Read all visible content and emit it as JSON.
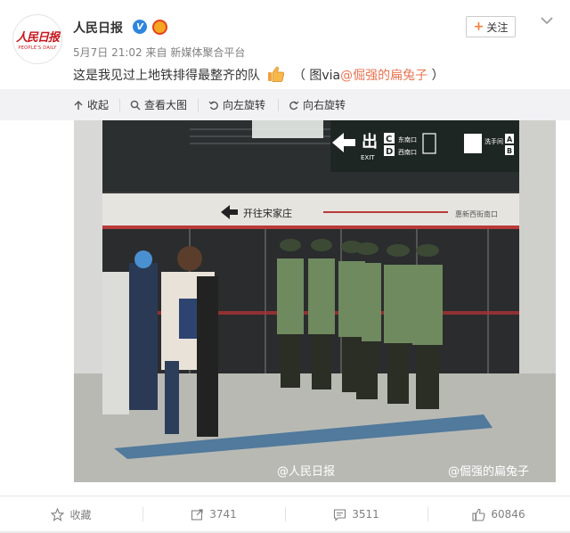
{
  "post": {
    "author": "人民日报",
    "verified_badge": "V",
    "time": "5月7日 21:02",
    "source_prefix": "来自",
    "source": "新媒体聚合平台",
    "follow_label": "关注",
    "text_main": "这是我见过上地铁排得最整齐的队",
    "text_credit_open": "（ 图via",
    "text_credit_link": "@倔强的扁兔子",
    "text_credit_close": " ）"
  },
  "avatar": {
    "logo": "人民日报",
    "sub": "PEOPLE'S DAILY"
  },
  "toolbar": {
    "collapse": "收起",
    "view_large": "查看大图",
    "rotate_left": "向左旋转",
    "rotate_right": "向右旋转"
  },
  "photo": {
    "exit_sign": "出",
    "exit_word": "EXIT",
    "exit_gates": [
      "C",
      "D"
    ],
    "exit_dirs": [
      "东南口",
      "西南口"
    ],
    "toilet_label": "洗手间",
    "toilet_gates": [
      "A",
      "B"
    ],
    "platform_direction": "开往宋家庄",
    "platform_right": "惠新西街南口",
    "watermark_1": "@人民日报",
    "watermark_2": "@倔强的扁兔子"
  },
  "footer": {
    "favorite": "收藏",
    "repost_count": "3741",
    "comment_count": "3511",
    "like_count": "60846"
  },
  "colors": {
    "link": "#eb7350",
    "accent_orange": "#fa7d3c",
    "verified_blue": "#2e86de",
    "toolbar_bg": "#f2f2f5"
  }
}
